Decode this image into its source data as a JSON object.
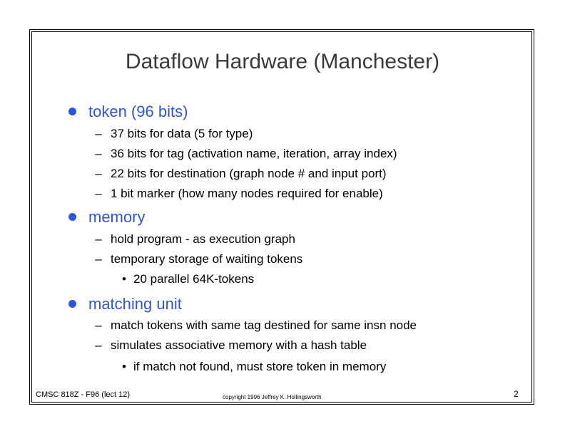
{
  "slide": {
    "title": "Dataflow Hardware (Manchester)",
    "sections": [
      {
        "heading": "token (96 bits)",
        "items": [
          "37 bits for data (5 for type)",
          "36 bits for tag (activation name, iteration, array index)",
          "22 bits for destination (graph node # and input port)",
          "1 bit marker (how many nodes required for enable)"
        ]
      },
      {
        "heading": "memory",
        "items": [
          "hold program - as execution graph",
          "temporary storage of waiting tokens"
        ],
        "subitems": [
          "20 parallel 64K-tokens"
        ]
      },
      {
        "heading": "matching unit",
        "items": [
          "match tokens with same tag destined for same insn node",
          "simulates associative memory with a hash table"
        ],
        "subitems": [
          "if match not found, must store token in memory"
        ]
      }
    ]
  },
  "footer": {
    "course": "CMSC 818Z - F96  (lect 12)",
    "copyright": "copyright 1996  Jeffrey K. Hollingsworth",
    "page_number": "2"
  },
  "colors": {
    "heading": "#2f54d8",
    "title": "#3a3a3a",
    "text": "#000000"
  },
  "glyphs": {
    "dash": "–",
    "sub_bullet": "•"
  }
}
